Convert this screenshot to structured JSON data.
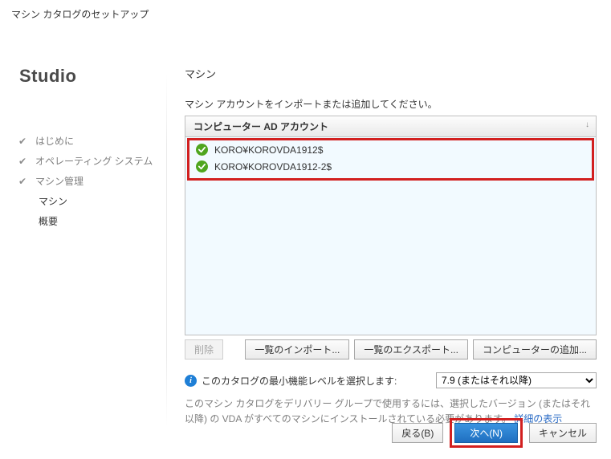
{
  "window_title": "マシン カタログのセットアップ",
  "brand": "Studio",
  "sidebar": {
    "items": [
      {
        "label": "はじめに",
        "done": true
      },
      {
        "label": "オペレーティング システム",
        "done": true
      },
      {
        "label": "マシン管理",
        "done": true
      },
      {
        "label": "マシン",
        "current": true
      },
      {
        "label": "概要",
        "current": false
      }
    ]
  },
  "content": {
    "heading": "マシン",
    "instruction": "マシン アカウントをインポートまたは追加してください。",
    "grid": {
      "column_header": "コンピューター AD アカウント",
      "rows": [
        {
          "account": "KORO¥KOROVDA1912$"
        },
        {
          "account": "KORO¥KOROVDA1912-2$"
        }
      ]
    },
    "buttons": {
      "delete": "削除",
      "import_list": "一覧のインポート...",
      "export_list": "一覧のエクスポート...",
      "add_computers": "コンピューターの追加..."
    },
    "level": {
      "label": "このカタログの最小機能レベルを選択します:",
      "selected": "7.9 (またはそれ以降)"
    },
    "note_text": "このマシン カタログをデリバリー グループで使用するには、選択したバージョン (またはそれ以降) の VDA がすべてのマシンにインストールされている必要があります。",
    "note_link": "詳細の表示",
    "footer": {
      "back": "戻る(B)",
      "next": "次へ(N)",
      "cancel": "キャンセル"
    }
  }
}
